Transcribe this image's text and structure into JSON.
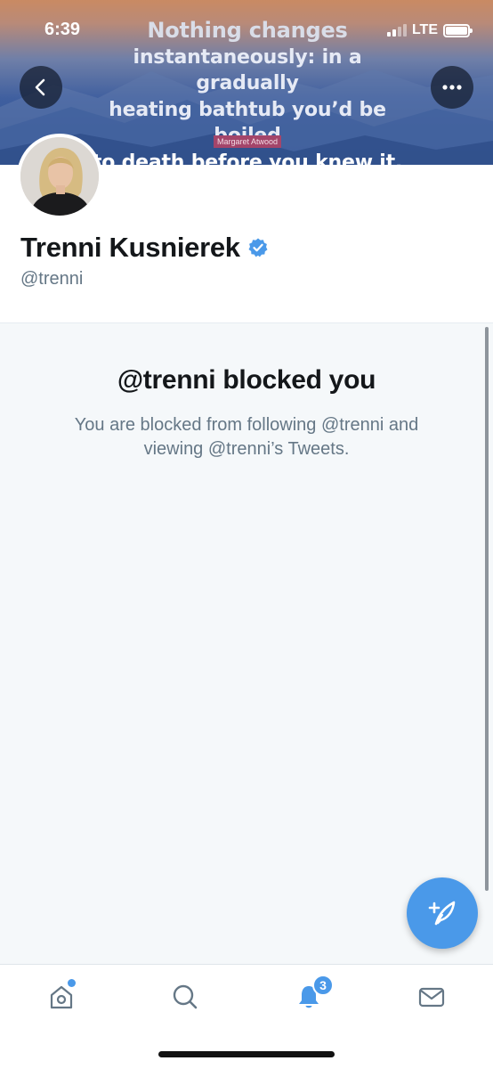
{
  "status_bar": {
    "time": "6:39",
    "network": "LTE"
  },
  "banner": {
    "quote_lines": [
      "Nothing changes",
      "instantaneously: in a gradually",
      "heating bathtub you’d be boiled",
      "to death before you knew it."
    ],
    "attribution": "Margaret Atwood"
  },
  "profile": {
    "name": "Trenni Kusnierek",
    "handle": "@trenni",
    "verified": true
  },
  "blocked": {
    "title": "@trenni blocked you",
    "message": "You are blocked from following @trenni and viewing @trenni’s Tweets."
  },
  "tabbar": {
    "notifications_badge": "3"
  },
  "icons": {
    "back": "chevron-left-icon",
    "more": "more-horizontal-icon",
    "verified": "verified-badge-icon",
    "compose": "compose-tweet-icon",
    "home": "home-icon",
    "search": "search-icon",
    "notifications": "bell-icon",
    "messages": "mail-icon"
  },
  "colors": {
    "accent": "#4a99e9",
    "panel_bg": "#f5f8fa",
    "secondary_text": "#657786",
    "primary_text": "#14171a"
  }
}
